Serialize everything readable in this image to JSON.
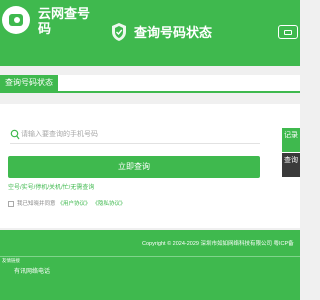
{
  "header": {
    "brand": "云网查号码",
    "page_title": "查询号码状态"
  },
  "breadcrumb": {
    "tab": "查询号码状态"
  },
  "search": {
    "placeholder": "请输入要查询的手机号码",
    "submit_label": "立即查询"
  },
  "hint": "空号/实号/停机/关机/忙/无需查询",
  "agreement": {
    "text": "我已知晓并同意",
    "user_agreement": "《用户协议》",
    "privacy": "《隐私协议》"
  },
  "side": {
    "records": "记录",
    "query": "查询"
  },
  "footer": {
    "copyright": "Copyright © 2024-2029 深圳市如如网络科技有限公司 粤ICP备",
    "friend_links_title": "友情链接",
    "friend_link": "有讯网络电话"
  },
  "colors": {
    "accent": "#3fb94e",
    "dark_tab": "#3a3a3a"
  }
}
